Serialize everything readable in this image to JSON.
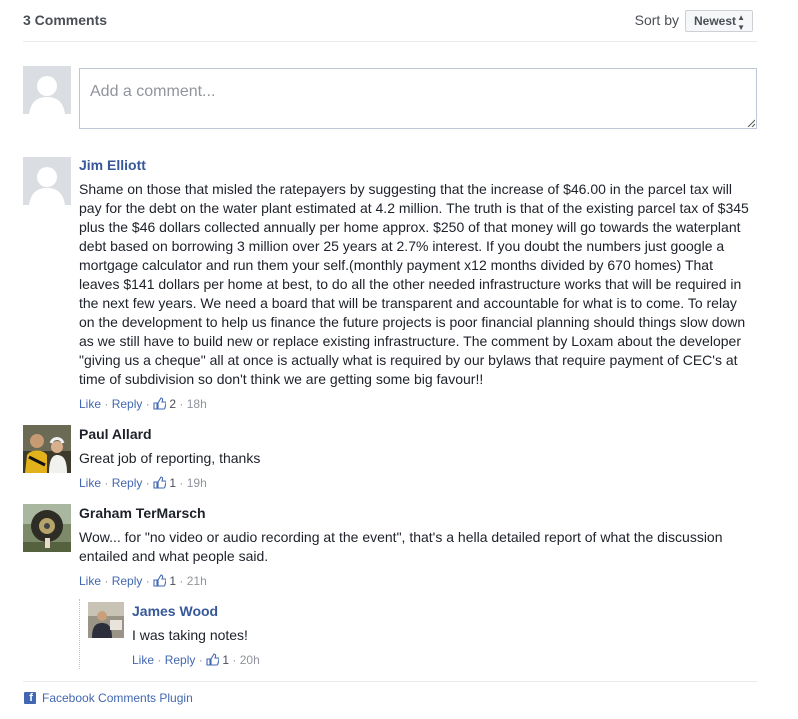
{
  "header": {
    "count_label": "3 Comments",
    "sort_label": "Sort by",
    "sort_value": "Newest"
  },
  "compose": {
    "placeholder": "Add a comment..."
  },
  "comments": [
    {
      "author": "Jim Elliott",
      "text": "Shame on those that misled the ratepayers by suggesting that the increase of $46.00 in the parcel tax will pay for the debt on the water plant estimated at 4.2 million. The truth is that of the existing parcel tax of $345 plus the $46 dollars collected annually per home approx. $250 of that money will go towards the waterplant debt based on borrowing 3 million over 25 years at 2.7% interest. If you doubt the numbers just google a mortgage calculator and run them your self.(monthly payment x12 months divided by 670 homes) That leaves $141 dollars per home at best, to do all the other needed infrastructure works that will be required in the next few years. We need a board that will be transparent and accountable for what is to come. To relay on the development to help us finance the future projects is poor financial planning should things slow down as we still have to build new or replace existing infrastructure. The comment by Loxam about the developer \"giving us a cheque\" all at once is actually what is required by our bylaws that require payment of CEC's at time of subdivision so don't think we are getting some big favour!!",
      "like": "Like",
      "reply": "Reply",
      "likes": "2",
      "time": "18h"
    },
    {
      "author": "Paul Allard",
      "text": "Great job of reporting, thanks",
      "like": "Like",
      "reply": "Reply",
      "likes": "1",
      "time": "19h"
    },
    {
      "author": "Graham TerMarsch",
      "text": "Wow... for \"no video or audio recording at the event\", that's a hella detailed report of what the discussion entailed and what people said.",
      "like": "Like",
      "reply": "Reply",
      "likes": "1",
      "time": "21h",
      "replies": [
        {
          "author": "James Wood",
          "text": "I was taking notes!",
          "like": "Like",
          "reply": "Reply",
          "likes": "1",
          "time": "20h"
        }
      ]
    }
  ],
  "footer": {
    "plugin_label": "Facebook Comments Plugin"
  },
  "colors": {
    "link": "#4267b2",
    "author_link": "#365899",
    "meta": "#90949c",
    "text": "#1d2129"
  }
}
